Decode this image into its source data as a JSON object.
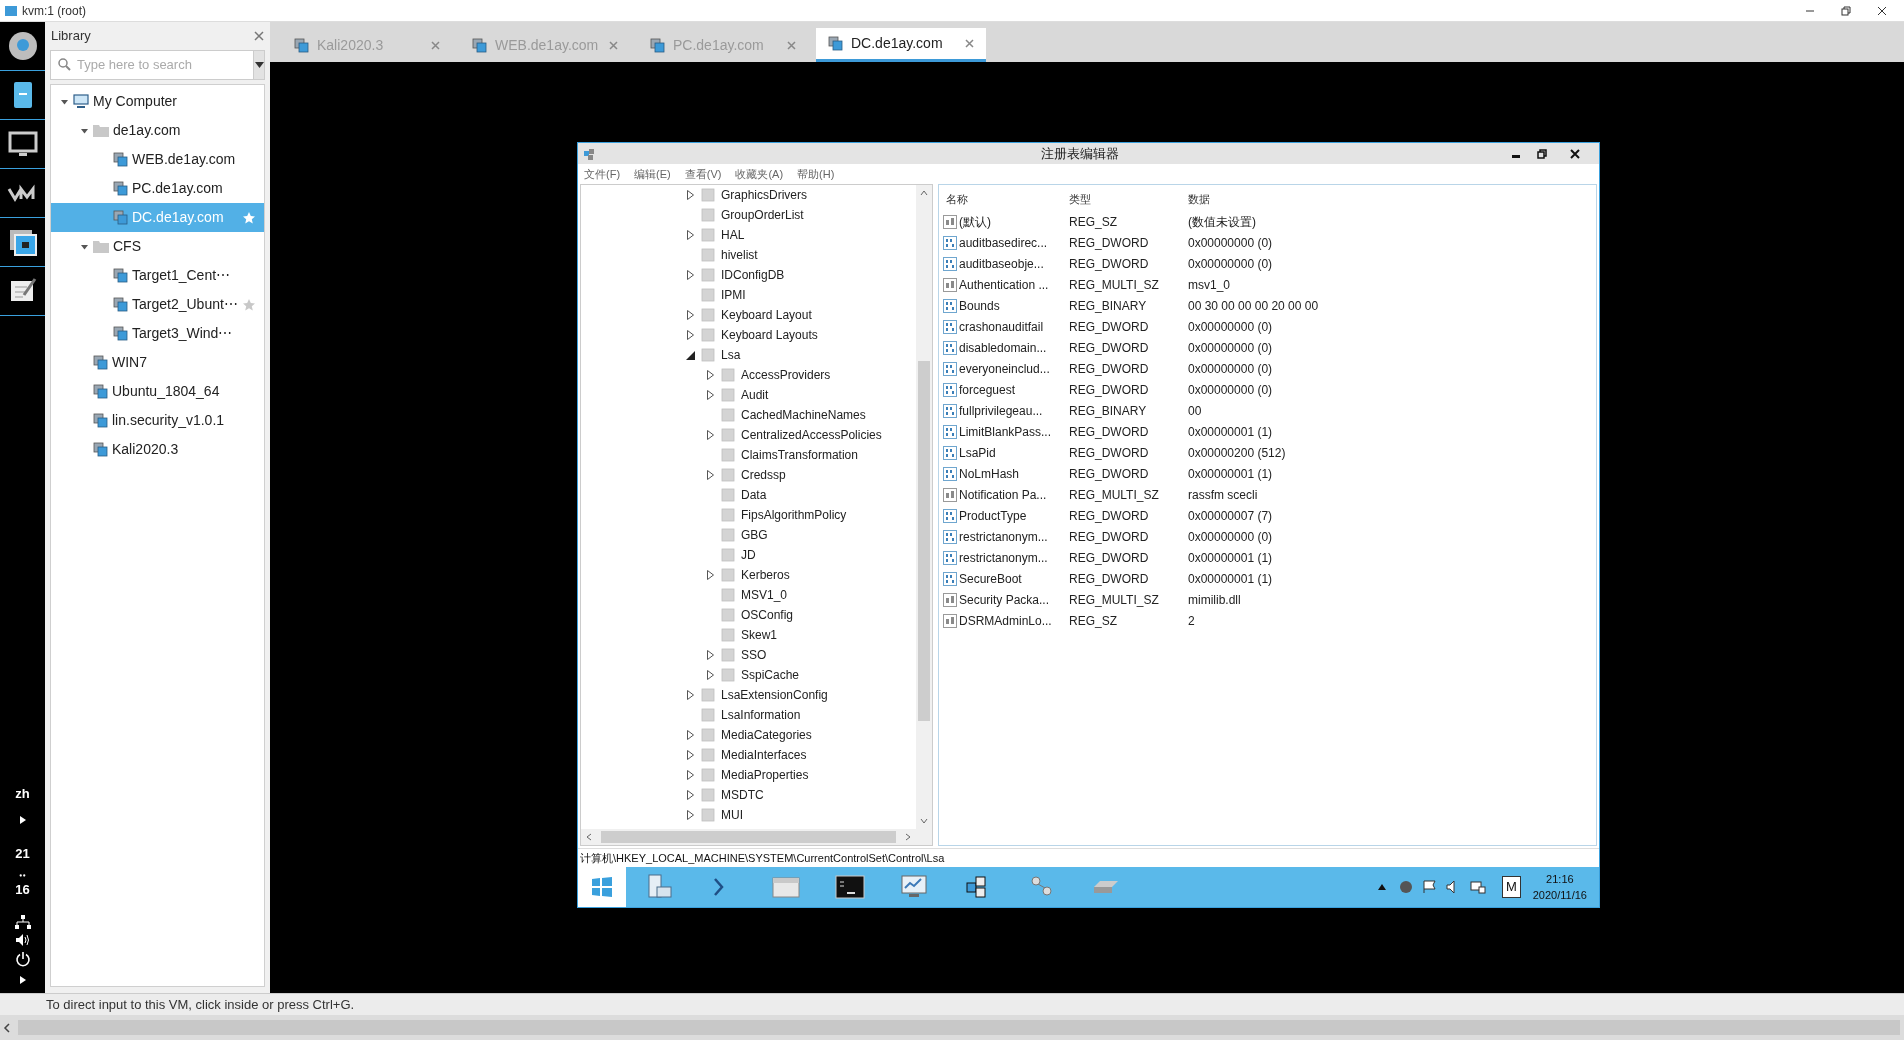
{
  "window": {
    "title": "kvm:1 (root)"
  },
  "dock": {
    "language": "zh",
    "clock": [
      "21",
      "‥",
      "16"
    ]
  },
  "library": {
    "title": "Library",
    "search": {
      "placeholder": "Type here to search"
    },
    "tree": [
      {
        "label": "My Computer",
        "kind": "computer",
        "expanded": true,
        "selected": false,
        "starred": false,
        "children": [
          {
            "label": "de1ay.com",
            "kind": "folder",
            "expanded": true,
            "selected": false,
            "starred": false,
            "children": [
              {
                "label": "WEB.de1ay.com",
                "kind": "vm",
                "selected": false,
                "starred": false
              },
              {
                "label": "PC.de1ay.com",
                "kind": "vm",
                "selected": false,
                "starred": false
              },
              {
                "label": "DC.de1ay.com",
                "kind": "vm",
                "selected": true,
                "starred": true
              }
            ]
          },
          {
            "label": "CFS",
            "kind": "folder",
            "expanded": true,
            "selected": false,
            "starred": false,
            "children": [
              {
                "label": "Target1_Cent⋯",
                "kind": "vm",
                "selected": false,
                "starred": false
              },
              {
                "label": "Target2_Ubunt⋯",
                "kind": "vm",
                "selected": false,
                "starred": true
              },
              {
                "label": "Target3_Wind⋯",
                "kind": "vm",
                "selected": false,
                "starred": false
              }
            ]
          },
          {
            "label": "WIN7",
            "kind": "vm",
            "selected": false,
            "starred": false
          },
          {
            "label": "Ubuntu_1804_64",
            "kind": "vm",
            "selected": false,
            "starred": false
          },
          {
            "label": "lin.security_v1.0.1",
            "kind": "vm",
            "selected": false,
            "starred": false
          },
          {
            "label": "Kali2020.3",
            "kind": "vm",
            "selected": false,
            "starred": false
          }
        ]
      }
    ]
  },
  "tabs": [
    {
      "label": "Kali2020.3",
      "selected": false
    },
    {
      "label": "WEB.de1ay.com",
      "selected": false
    },
    {
      "label": "PC.de1ay.com",
      "selected": false
    },
    {
      "label": "DC.de1ay.com",
      "selected": true
    }
  ],
  "regedit": {
    "title": "注册表编辑器",
    "menu": [
      "文件(F)",
      "编辑(E)",
      "查看(V)",
      "收藏夹(A)",
      "帮助(H)"
    ],
    "tree": [
      {
        "label": "GraphicsDrivers",
        "kind": "branch",
        "expanded": false
      },
      {
        "label": "GroupOrderList",
        "kind": "leaf"
      },
      {
        "label": "HAL",
        "kind": "branch",
        "expanded": false
      },
      {
        "label": "hivelist",
        "kind": "leaf"
      },
      {
        "label": "IDConfigDB",
        "kind": "branch",
        "expanded": false
      },
      {
        "label": "IPMI",
        "kind": "leaf"
      },
      {
        "label": "Keyboard Layout",
        "kind": "branch",
        "expanded": false
      },
      {
        "label": "Keyboard Layouts",
        "kind": "branch",
        "expanded": false
      },
      {
        "label": "Lsa",
        "kind": "branch",
        "expanded": true,
        "children": [
          {
            "label": "AccessProviders",
            "kind": "branch",
            "expanded": false
          },
          {
            "label": "Audit",
            "kind": "branch",
            "expanded": false
          },
          {
            "label": "CachedMachineNames",
            "kind": "leaf"
          },
          {
            "label": "CentralizedAccessPolicies",
            "kind": "branch",
            "expanded": false
          },
          {
            "label": "ClaimsTransformation",
            "kind": "leaf"
          },
          {
            "label": "Credssp",
            "kind": "branch",
            "expanded": false
          },
          {
            "label": "Data",
            "kind": "leaf"
          },
          {
            "label": "FipsAlgorithmPolicy",
            "kind": "leaf"
          },
          {
            "label": "GBG",
            "kind": "leaf"
          },
          {
            "label": "JD",
            "kind": "leaf"
          },
          {
            "label": "Kerberos",
            "kind": "branch",
            "expanded": false
          },
          {
            "label": "MSV1_0",
            "kind": "leaf"
          },
          {
            "label": "OSConfig",
            "kind": "leaf"
          },
          {
            "label": "Skew1",
            "kind": "leaf"
          },
          {
            "label": "SSO",
            "kind": "branch",
            "expanded": false
          },
          {
            "label": "SspiCache",
            "kind": "branch",
            "expanded": false
          }
        ]
      },
      {
        "label": "LsaExtensionConfig",
        "kind": "branch",
        "expanded": false
      },
      {
        "label": "LsaInformation",
        "kind": "leaf"
      },
      {
        "label": "MediaCategories",
        "kind": "branch",
        "expanded": false
      },
      {
        "label": "MediaInterfaces",
        "kind": "branch",
        "expanded": false
      },
      {
        "label": "MediaProperties",
        "kind": "branch",
        "expanded": false
      },
      {
        "label": "MSDTC",
        "kind": "branch",
        "expanded": false
      },
      {
        "label": "MUI",
        "kind": "branch",
        "expanded": false
      }
    ],
    "columns": [
      "名称",
      "类型",
      "数据"
    ],
    "values": [
      {
        "name": "(默认)",
        "type": "REG_SZ",
        "data": "(数值未设置)",
        "kind": "string"
      },
      {
        "name": "auditbasedirec...",
        "type": "REG_DWORD",
        "data": "0x00000000 (0)",
        "kind": "binary"
      },
      {
        "name": "auditbaseobje...",
        "type": "REG_DWORD",
        "data": "0x00000000 (0)",
        "kind": "binary"
      },
      {
        "name": "Authentication ...",
        "type": "REG_MULTI_SZ",
        "data": "msv1_0",
        "kind": "string"
      },
      {
        "name": "Bounds",
        "type": "REG_BINARY",
        "data": "00 30 00 00 00 20 00 00",
        "kind": "binary"
      },
      {
        "name": "crashonauditfail",
        "type": "REG_DWORD",
        "data": "0x00000000 (0)",
        "kind": "binary"
      },
      {
        "name": "disabledomain...",
        "type": "REG_DWORD",
        "data": "0x00000000 (0)",
        "kind": "binary"
      },
      {
        "name": "everyoneinclud...",
        "type": "REG_DWORD",
        "data": "0x00000000 (0)",
        "kind": "binary"
      },
      {
        "name": "forceguest",
        "type": "REG_DWORD",
        "data": "0x00000000 (0)",
        "kind": "binary"
      },
      {
        "name": "fullprivilegeau...",
        "type": "REG_BINARY",
        "data": "00",
        "kind": "binary"
      },
      {
        "name": "LimitBlankPass...",
        "type": "REG_DWORD",
        "data": "0x00000001 (1)",
        "kind": "binary"
      },
      {
        "name": "LsaPid",
        "type": "REG_DWORD",
        "data": "0x00000200 (512)",
        "kind": "binary"
      },
      {
        "name": "NoLmHash",
        "type": "REG_DWORD",
        "data": "0x00000001 (1)",
        "kind": "binary"
      },
      {
        "name": "Notification Pa...",
        "type": "REG_MULTI_SZ",
        "data": "rassfm scecli",
        "kind": "string"
      },
      {
        "name": "ProductType",
        "type": "REG_DWORD",
        "data": "0x00000007 (7)",
        "kind": "binary"
      },
      {
        "name": "restrictanonym...",
        "type": "REG_DWORD",
        "data": "0x00000000 (0)",
        "kind": "binary"
      },
      {
        "name": "restrictanonym...",
        "type": "REG_DWORD",
        "data": "0x00000001 (1)",
        "kind": "binary"
      },
      {
        "name": "SecureBoot",
        "type": "REG_DWORD",
        "data": "0x00000001 (1)",
        "kind": "binary"
      },
      {
        "name": "Security Packa...",
        "type": "REG_MULTI_SZ",
        "data": "mimilib.dll",
        "kind": "string"
      },
      {
        "name": "DSRMAdminLo...",
        "type": "REG_SZ",
        "data": "2",
        "kind": "string"
      }
    ],
    "address": "计算机\\HKEY_LOCAL_MACHINE\\SYSTEM\\CurrentControlSet\\Control\\Lsa"
  },
  "taskbar": {
    "ime": "M",
    "time": "21:16",
    "date": "2020/11/16"
  },
  "status_bar": "To direct input to this VM, click inside or press Ctrl+G."
}
